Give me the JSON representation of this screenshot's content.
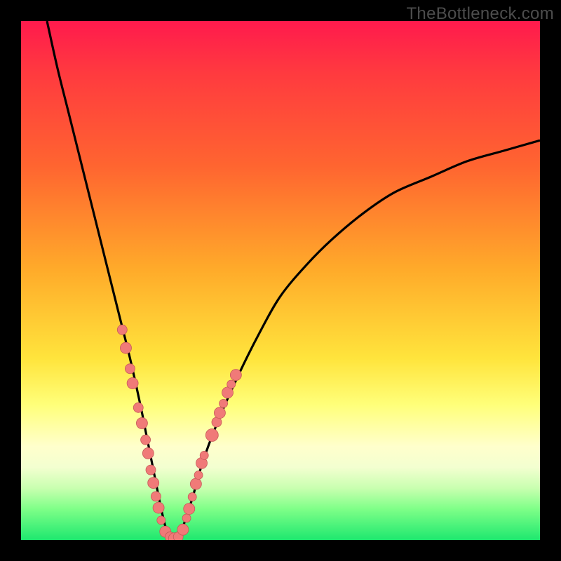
{
  "watermark": "TheBottleneck.com",
  "colors": {
    "frame": "#000000",
    "gradient_top": "#ff1a4d",
    "gradient_mid": "#ffe43c",
    "gradient_bottom": "#1ee86f",
    "curve": "#000000",
    "dots_fill": "#f07a78",
    "dots_stroke": "#c65a58"
  },
  "chart_data": {
    "type": "line",
    "title": "",
    "xlabel": "",
    "ylabel": "",
    "xlim": [
      0,
      100
    ],
    "ylim": [
      0,
      100
    ],
    "series": [
      {
        "name": "bottleneck-curve",
        "x": [
          5,
          7,
          9,
          11,
          13,
          15,
          17,
          19,
          21,
          23,
          24,
          25,
          26,
          27,
          28,
          29,
          30,
          31,
          33,
          35,
          38,
          42,
          46,
          50,
          55,
          60,
          66,
          72,
          79,
          86,
          93,
          100
        ],
        "values": [
          100,
          91,
          83,
          75,
          67,
          59,
          51,
          43,
          35,
          26,
          21,
          16,
          11,
          6,
          2,
          0,
          0,
          2,
          8,
          15,
          23,
          32,
          40,
          47,
          53,
          58,
          63,
          67,
          70,
          73,
          75,
          77
        ]
      }
    ],
    "markers": [
      {
        "x": 19.5,
        "y": 40.5,
        "r": 7
      },
      {
        "x": 20.2,
        "y": 37.0,
        "r": 8
      },
      {
        "x": 21.0,
        "y": 33.0,
        "r": 7
      },
      {
        "x": 21.5,
        "y": 30.2,
        "r": 8
      },
      {
        "x": 22.6,
        "y": 25.5,
        "r": 7
      },
      {
        "x": 23.3,
        "y": 22.5,
        "r": 8
      },
      {
        "x": 24.0,
        "y": 19.3,
        "r": 7
      },
      {
        "x": 24.5,
        "y": 16.7,
        "r": 8
      },
      {
        "x": 25.0,
        "y": 13.5,
        "r": 7
      },
      {
        "x": 25.5,
        "y": 11.0,
        "r": 8
      },
      {
        "x": 26.0,
        "y": 8.4,
        "r": 7
      },
      {
        "x": 26.5,
        "y": 6.2,
        "r": 8
      },
      {
        "x": 27.0,
        "y": 3.8,
        "r": 6
      },
      {
        "x": 27.8,
        "y": 1.6,
        "r": 8
      },
      {
        "x": 28.7,
        "y": 0.6,
        "r": 7
      },
      {
        "x": 29.5,
        "y": 0.3,
        "r": 8
      },
      {
        "x": 30.3,
        "y": 0.6,
        "r": 7
      },
      {
        "x": 31.2,
        "y": 2.0,
        "r": 8
      },
      {
        "x": 31.9,
        "y": 4.2,
        "r": 6
      },
      {
        "x": 32.4,
        "y": 6.0,
        "r": 8
      },
      {
        "x": 33.0,
        "y": 8.3,
        "r": 6
      },
      {
        "x": 33.7,
        "y": 10.8,
        "r": 8
      },
      {
        "x": 34.2,
        "y": 12.5,
        "r": 6
      },
      {
        "x": 34.8,
        "y": 14.8,
        "r": 8
      },
      {
        "x": 35.3,
        "y": 16.3,
        "r": 6
      },
      {
        "x": 36.8,
        "y": 20.2,
        "r": 9
      },
      {
        "x": 37.7,
        "y": 22.7,
        "r": 7
      },
      {
        "x": 38.3,
        "y": 24.5,
        "r": 8
      },
      {
        "x": 39.0,
        "y": 26.3,
        "r": 6
      },
      {
        "x": 39.8,
        "y": 28.4,
        "r": 8
      },
      {
        "x": 40.5,
        "y": 30.0,
        "r": 6
      },
      {
        "x": 41.4,
        "y": 31.8,
        "r": 8
      }
    ]
  }
}
